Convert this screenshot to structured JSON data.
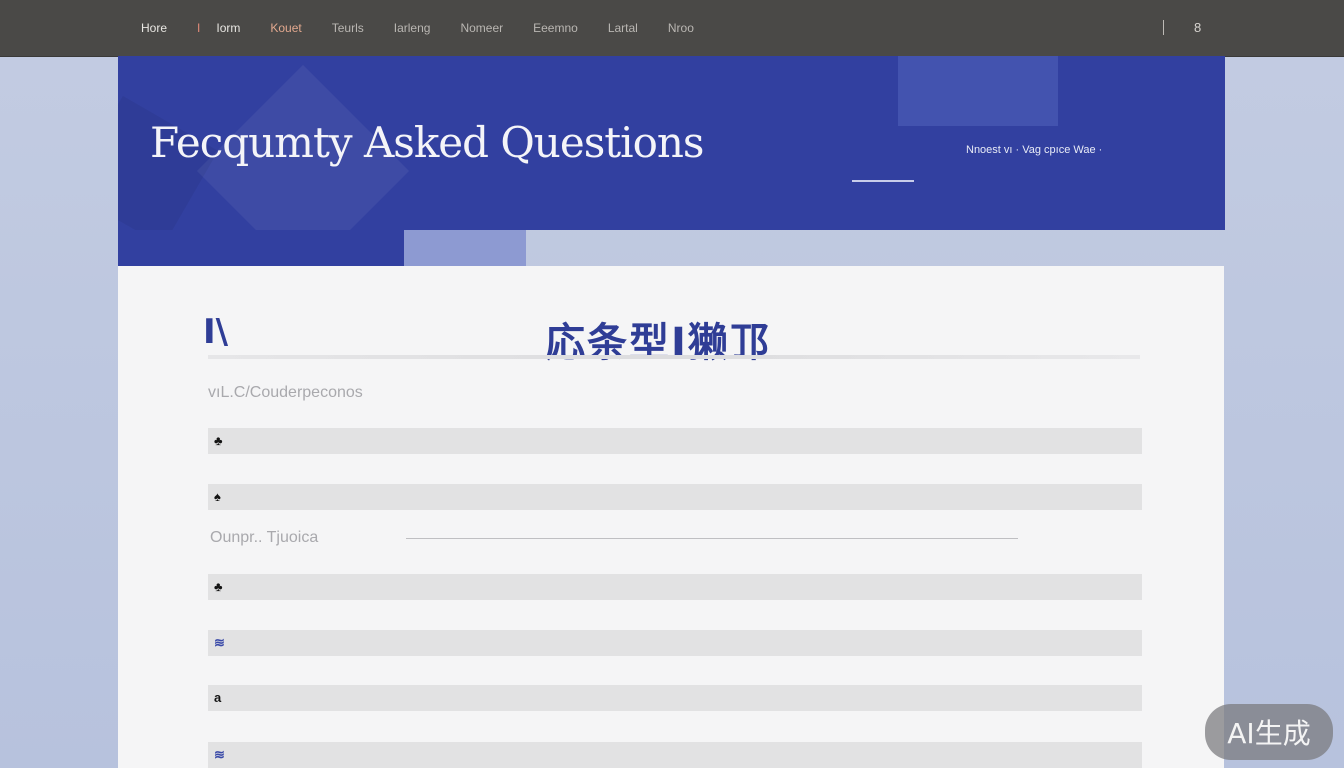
{
  "nav": {
    "items": [
      "Hore",
      "Iorm",
      "Kouet",
      "Teurls",
      "Iarleng",
      "Nomeer",
      "Eeemno",
      "Lartal",
      "Nroo"
    ],
    "separator": "I",
    "right_icon": "8"
  },
  "hero": {
    "title": "Fecqumty Asked Questions",
    "meta": "Nnoest vı ·  Vag cpıce  Wae   ·"
  },
  "card": {
    "mark": "I\\",
    "heading": "応条型I獭邒",
    "sections": [
      {
        "label": "vıL.C/Couderpeconos"
      },
      {
        "label": "Ounpr.. Tjuoica"
      }
    ],
    "rows": [
      {
        "icon": "♣",
        "icon_name": "marker-icon"
      },
      {
        "icon": "♠",
        "icon_name": "marker-icon"
      },
      {
        "icon": "♣",
        "icon_name": "marker-icon"
      },
      {
        "icon": "≋",
        "icon_name": "marker-icon"
      },
      {
        "icon": "a",
        "icon_name": "marker-icon"
      },
      {
        "icon": "≋",
        "icon_name": "marker-icon"
      }
    ]
  },
  "badge": {
    "text": "AI生成"
  },
  "colors": {
    "accent": "#3240a0",
    "topbar": "#4a4947",
    "card": "#f5f5f6"
  }
}
